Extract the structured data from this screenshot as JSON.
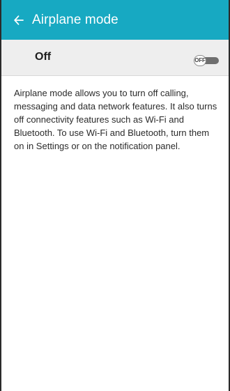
{
  "app_bar": {
    "back_icon": "arrow-left-icon",
    "title": "Airplane mode",
    "background_color": "#17a9c2"
  },
  "settings_row": {
    "label": "Off",
    "toggle": {
      "state": "off",
      "label": "OFF"
    }
  },
  "description": "Airplane mode allows you to turn off calling, messaging and data network features. It also turns off connectivity features such as Wi-Fi and Bluetooth. To use Wi-Fi and Bluetooth, turn them on in Settings or on the notification panel."
}
